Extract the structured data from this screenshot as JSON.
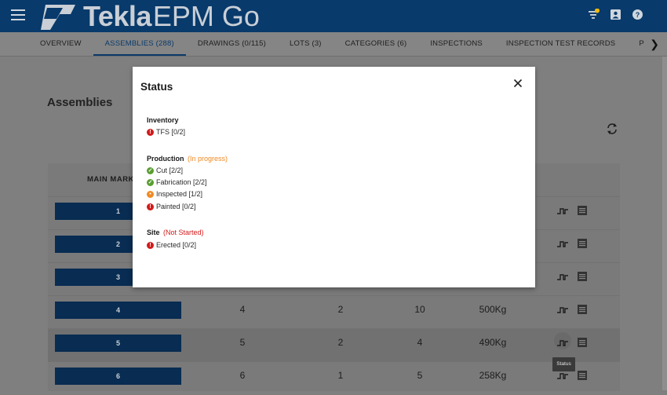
{
  "app": {
    "brand": "Tekla",
    "product": "EPM Go"
  },
  "nav": {
    "tabs": [
      {
        "label": "OVERVIEW"
      },
      {
        "label": "ASSEMBLIES (288)"
      },
      {
        "label": "DRAWINGS (0/115)"
      },
      {
        "label": "LOTS (3)"
      },
      {
        "label": "CATEGORIES (6)"
      },
      {
        "label": "INSPECTIONS"
      },
      {
        "label": "INSPECTION TEST RECORDS"
      },
      {
        "label": "PREPARED CUT LISTS"
      }
    ]
  },
  "page": {
    "title": "Assemblies"
  },
  "table": {
    "column_main_mark": "MAIN MARK",
    "rows": [
      {
        "mark": "1",
        "qty": "",
        "c2": "",
        "c3": "",
        "weight": ""
      },
      {
        "mark": "2",
        "qty": "",
        "c2": "",
        "c3": "",
        "weight": ""
      },
      {
        "mark": "3",
        "qty": "",
        "c2": "",
        "c3": "",
        "weight": ""
      },
      {
        "mark": "4",
        "qty": "4",
        "c2": "2",
        "c3": "10",
        "weight": "500Kg"
      },
      {
        "mark": "5",
        "qty": "5",
        "c2": "2",
        "c3": "4",
        "weight": "490Kg"
      },
      {
        "mark": "6",
        "qty": "6",
        "c2": "1",
        "c3": "5",
        "weight": "258Kg"
      }
    ]
  },
  "tooltip": "Status",
  "colors": {
    "ok": "#5a9e32",
    "warn": "#f08a24",
    "error": "#d21a1a",
    "brand": "#0a4a86"
  },
  "modal": {
    "title": "Status",
    "sections": [
      {
        "label": "Inventory",
        "status": "",
        "items": [
          {
            "label": "TFS [0/2]",
            "state": "error"
          }
        ]
      },
      {
        "label": "Production",
        "status": "(In progress)",
        "items": [
          {
            "label": "Cut [2/2]",
            "state": "ok"
          },
          {
            "label": "Fabrication [2/2]",
            "state": "ok"
          },
          {
            "label": "Inspected [1/2]",
            "state": "warn"
          },
          {
            "label": "Painted [0/2]",
            "state": "error"
          }
        ]
      },
      {
        "label": "Site",
        "status": "(Not Started)",
        "items": [
          {
            "label": "Erected [0/2]",
            "state": "error"
          }
        ]
      }
    ]
  }
}
